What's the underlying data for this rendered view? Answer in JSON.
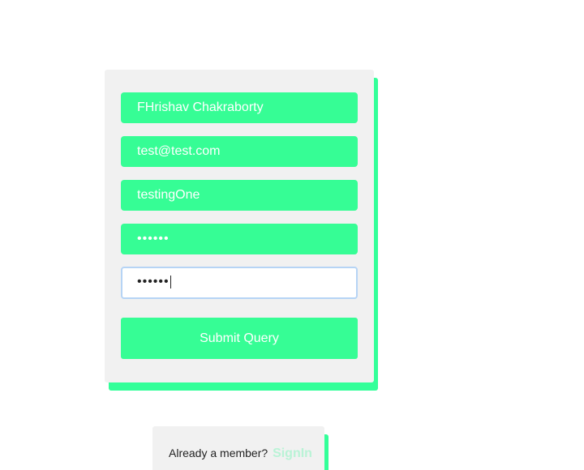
{
  "signup_form": {
    "name_value": "FHrishav Chakraborty",
    "email_value": "test@test.com",
    "username_value": "testingOne",
    "password_value": "••••••",
    "confirm_password_value": "••••••",
    "submit_label": "Submit Query"
  },
  "footer": {
    "prompt": "Already a member?",
    "signin_label": "SignIn"
  },
  "colors": {
    "accent": "#36fd95",
    "card_bg": "#f1f1f1",
    "focus_border": "#b6d4f5",
    "link": "#b9f3d6"
  }
}
